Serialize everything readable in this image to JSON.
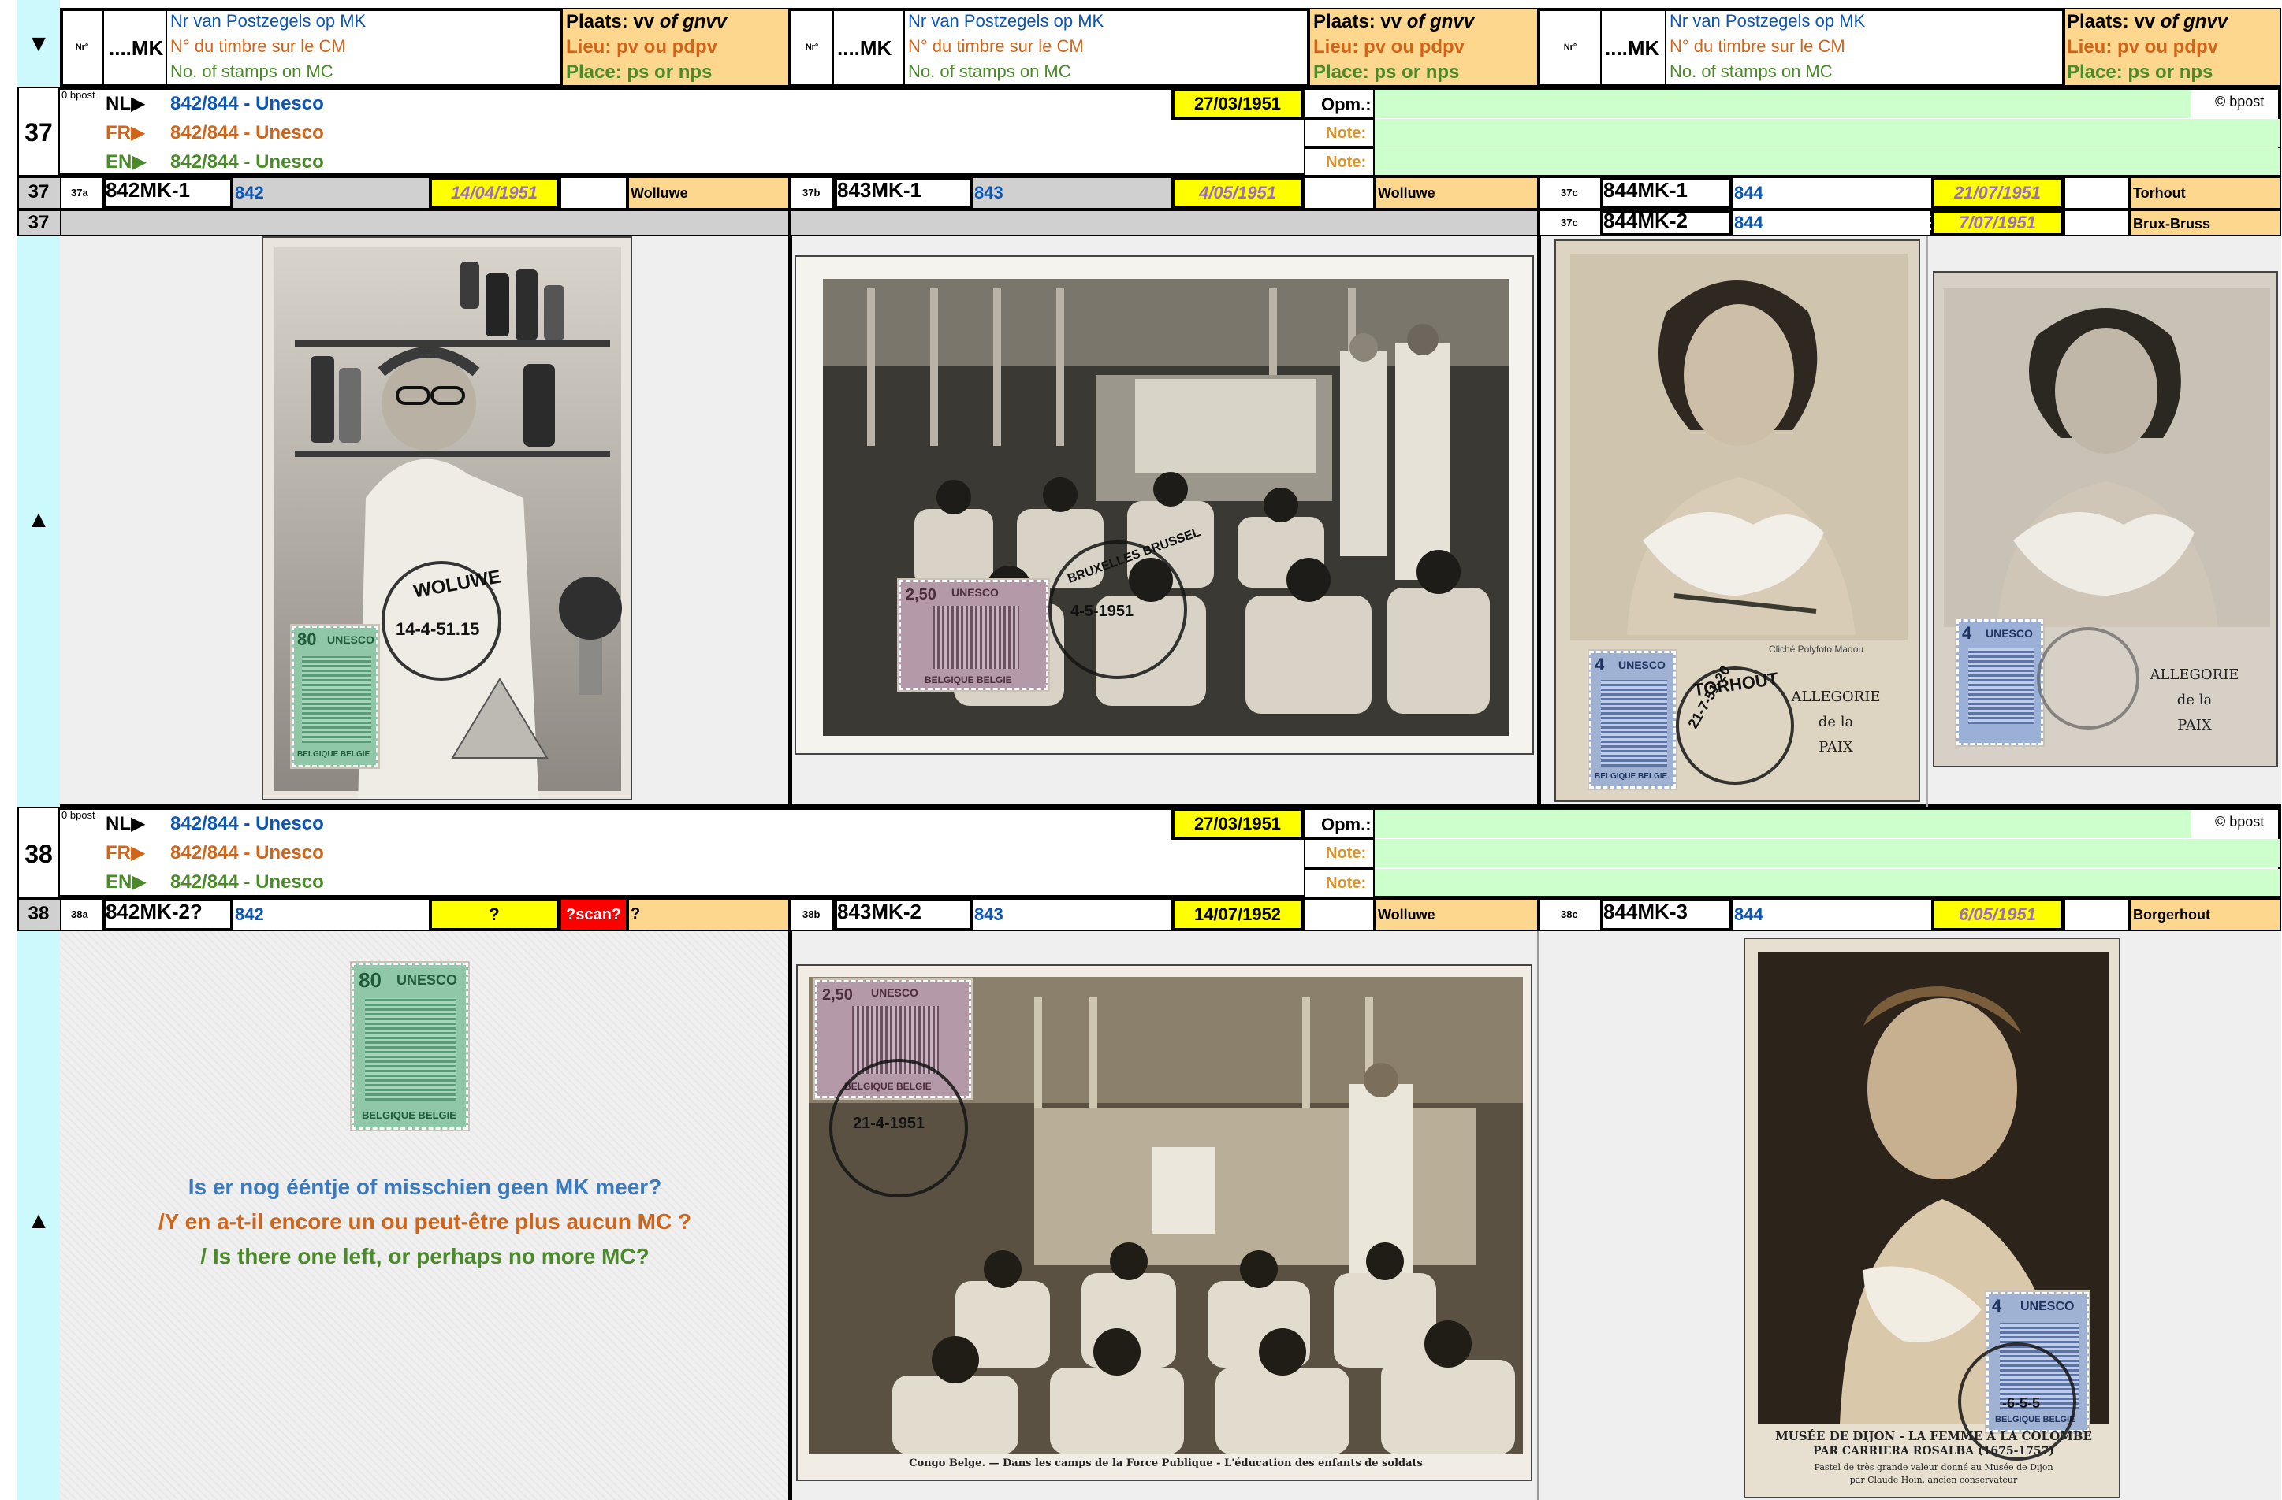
{
  "header": {
    "nav_down": "▼",
    "nr_col": "Nr°",
    "mk_col": "....MK",
    "desc_nl": "Nr van Postzegels op MK",
    "desc_fr": "N° du timbre sur le CM",
    "desc_en": "No. of stamps on MC",
    "place_nl_pre": "Plaats: vv ",
    "place_nl_em": "of gnvv",
    "place_fr": "Lieu: pv ou pdpv",
    "place_en": "Place: ps or nps"
  },
  "colors": {
    "cyan": "#ccf9fb",
    "tan": "#fdd78d",
    "yellow": "#ffff00",
    "green": "#ccffcc",
    "red": "#ff0000",
    "blue": "#0b55b4",
    "orange": "#d0651a",
    "purple": "#7030a0"
  },
  "icons": [
    "triangle-down-icon",
    "triangle-up-icon",
    "triangle-right-icon"
  ],
  "entries": [
    {
      "nr": "37",
      "bpost_small": "0 bpost",
      "copyright": "© bpost",
      "lang": [
        {
          "code": "NL",
          "title": "842/844 - Unesco"
        },
        {
          "code": "FR",
          "title": "842/844 - Unesco"
        },
        {
          "code": "EN",
          "title": "842/844 - Unesco"
        }
      ],
      "issue_date": "27/03/1951",
      "opm_label": "Opm.:",
      "note_label_fr": "Note:",
      "note_label_en": "Note:",
      "nav_up": "▲",
      "cards": [
        {
          "sub": "37a",
          "mk": "842MK-1",
          "stamp": "842",
          "date": "14/04/1951",
          "place": "Wolluwe"
        },
        {
          "sub": "37b",
          "mk": "843MK-1",
          "stamp": "843",
          "date": "4/05/1951",
          "place": "Wolluwe"
        },
        {
          "sub": "37c",
          "mk": "844MK-1",
          "stamp": "844",
          "date": "21/07/1951",
          "place": "Torhout"
        },
        {
          "sub": "37c",
          "mk": "844MK-2",
          "stamp": "844",
          "date": "7/07/1951",
          "place": "Brux-Bruss"
        }
      ],
      "card_texts": {
        "card3_credit": "Cliché Polyfoto Madou",
        "card3_caption": [
          "ALLEGORIE",
          "de la",
          "PAIX"
        ],
        "card4_caption": [
          "ALLEGORIE",
          "de la",
          "PAIX"
        ]
      }
    },
    {
      "nr": "38",
      "bpost_small": "0 bpost",
      "copyright": "© bpost",
      "lang": [
        {
          "code": "NL",
          "title": "842/844 - Unesco"
        },
        {
          "code": "FR",
          "title": "842/844 - Unesco"
        },
        {
          "code": "EN",
          "title": "842/844 - Unesco"
        }
      ],
      "issue_date": "27/03/1951",
      "opm_label": "Opm.:",
      "note_label_fr": "Note:",
      "note_label_en": "Note:",
      "nav_up": "▲",
      "cards": [
        {
          "sub": "38a",
          "mk": "842MK-2?",
          "stamp": "842",
          "date": "?",
          "scan": "?scan?",
          "place": "?"
        },
        {
          "sub": "38b",
          "mk": "843MK-2",
          "stamp": "843",
          "date": "14/07/1952",
          "place": "Wolluwe"
        },
        {
          "sub": "38c",
          "mk": "844MK-3",
          "stamp": "844",
          "date": "6/05/1951",
          "place": "Borgerhout"
        }
      ],
      "question": {
        "nl": "Is er nog ééntje of misschien geen MK meer?",
        "fr": "/Y en a-t-il encore un ou peut-être plus aucun MC ?",
        "en": "/ Is there one left, or perhaps no more MC?"
      },
      "card_texts": {
        "card2_caption": "Congo Belge. — Dans les camps de la Force Publique - L'éducation des enfants de soldats",
        "card3_caption_1": "MUSÉE DE DIJON - LA FEMME A LA COLOMBE",
        "card3_caption_2": "PAR CARRIERA ROSALBA (1675-1757)",
        "card3_caption_3": "Pastel de très grande valeur donné au Musée de Dijon",
        "card3_caption_4": "par Claude Hoin, ancien conservateur"
      }
    }
  ],
  "stamp_texts": {
    "unesco": "UNESCO",
    "country": "BELGIQUE BELGIE",
    "v842": "80",
    "v843": "2,50",
    "v844": "4"
  },
  "postmark_texts": {
    "pm1": "WOLUWE",
    "pm1_date": "14-4-51.15",
    "pm2": "BRUXELLES BRUSSEL",
    "pm2_date": "4-5-1951",
    "pm3": "TORHOUT",
    "pm3_date": "21-7-51-20",
    "pm5_date": "21-4-1951",
    "pm6_date": "-6-5-5"
  }
}
